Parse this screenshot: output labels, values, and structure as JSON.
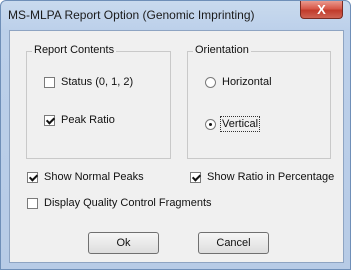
{
  "window": {
    "title": "MS-MLPA Report Option (Genomic Imprinting)",
    "close_glyph": "X"
  },
  "report_contents": {
    "title": "Report Contents",
    "status_label": "Status (0, 1, 2)",
    "status_checked": false,
    "peak_ratio_label": "Peak Ratio",
    "peak_ratio_checked": true
  },
  "orientation": {
    "title": "Orientation",
    "horizontal_label": "Horizontal",
    "vertical_label": "Vertical",
    "selected": "Vertical"
  },
  "options": {
    "show_normal_peaks_label": "Show Normal Peaks",
    "show_normal_peaks_checked": true,
    "show_ratio_percentage_label": "Show Ratio in Percentage",
    "show_ratio_percentage_checked": true,
    "display_qc_fragments_label": "Display Quality Control Fragments",
    "display_qc_fragments_checked": false
  },
  "buttons": {
    "ok_label": "Ok",
    "cancel_label": "Cancel"
  },
  "colors": {
    "title_bar": "#c3d6ee",
    "close_button": "#c94a3a",
    "dialog_face": "#f0f0f0"
  },
  "icons": [
    "close-icon",
    "checkbox-icon",
    "radio-icon"
  ]
}
